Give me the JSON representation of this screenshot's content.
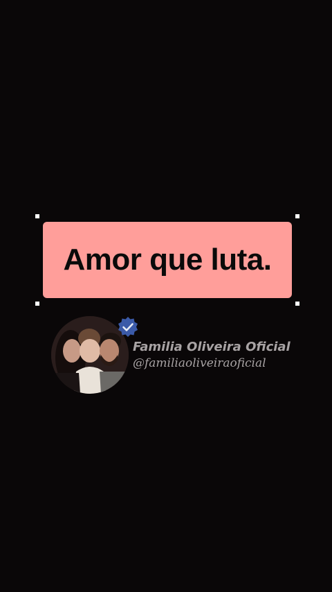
{
  "caption": {
    "text": "Amor que luta."
  },
  "watermark": {
    "name": "Familia Oliveira Oficial",
    "handle": "@familiaoliveiraoficial",
    "verified_icon": "verified-badge-icon"
  },
  "colors": {
    "background": "#0a0708",
    "caption_bg": "#ff9e9a",
    "caption_text": "#0a0a0a",
    "watermark_text": "#a8a3a4",
    "badge": "#3b5aa8"
  }
}
